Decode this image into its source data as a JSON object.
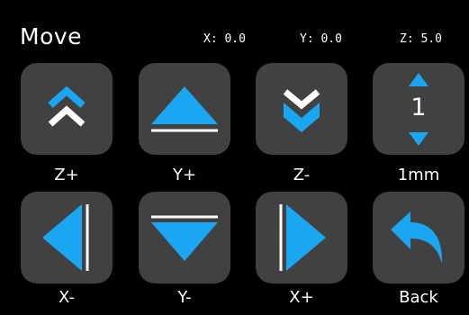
{
  "header": {
    "title": "Move",
    "x_readout": "X: 0.0",
    "y_readout": "Y: 0.0",
    "z_readout": "Z: 5.0"
  },
  "buttons": {
    "z_plus": "Z+",
    "y_plus": "Y+",
    "z_minus": "Z-",
    "step_value": "1",
    "step_label": "1mm",
    "x_minus": "X-",
    "y_minus": "Y-",
    "x_plus": "X+",
    "back": "Back"
  },
  "icons": {
    "z_plus": "double-chevron-up-icon",
    "y_plus": "triangle-up-icon",
    "z_minus": "double-chevron-down-icon",
    "step_up": "arrow-up-icon",
    "step_down": "arrow-down-icon",
    "x_minus": "triangle-left-icon",
    "y_minus": "triangle-down-icon",
    "x_plus": "triangle-right-icon",
    "back": "back-arrow-icon"
  },
  "colors": {
    "background": "#000000",
    "button": "#414141",
    "accent": "#1aa6f0",
    "text": "#ffffff"
  }
}
